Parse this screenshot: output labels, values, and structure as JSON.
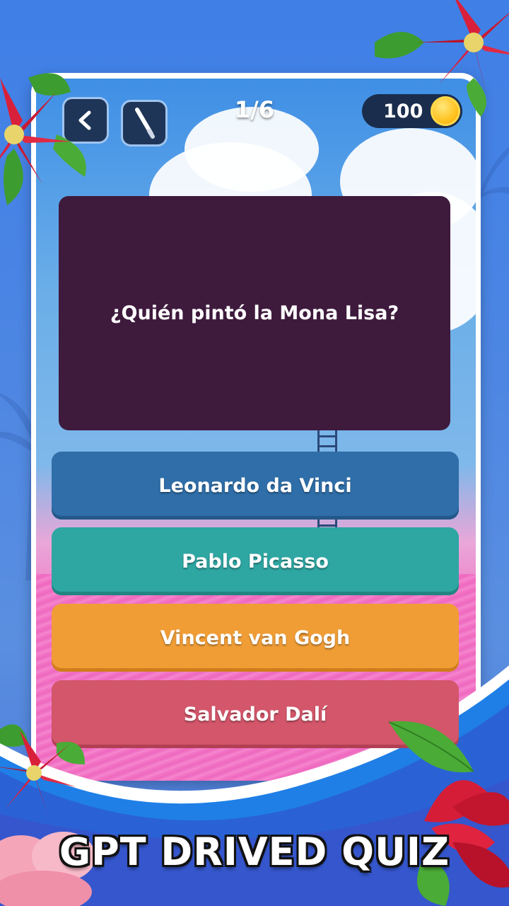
{
  "progress": {
    "label": "1/6"
  },
  "coins": {
    "value": "100",
    "icon": "coin-icon"
  },
  "toolbar": {
    "back_icon": "back-arrow-icon",
    "hint_icon": "magic-wand-icon"
  },
  "question": {
    "text": "¿Quién pintó la Mona Lisa?"
  },
  "answers": [
    {
      "label": "Leonardo da Vinci",
      "color": "#2f6ea8"
    },
    {
      "label": "Pablo Picasso",
      "color": "#2ea6a2"
    },
    {
      "label": "Vincent van Gogh",
      "color": "#f09d36"
    },
    {
      "label": "Salvador Dalí",
      "color": "#d3566a"
    }
  ],
  "banner": {
    "title": "GPT DRIVED QUIZ"
  },
  "colors": {
    "background": "#4a82e2",
    "question_card": "#3e1a3d",
    "frame": "#ffffff"
  }
}
